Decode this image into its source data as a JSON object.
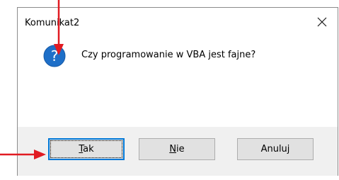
{
  "dialog": {
    "title": "Komunikat2",
    "message": "Czy programowanie w VBA jest fajne?",
    "buttons": [
      {
        "label": "Tak",
        "mnemonic": "T",
        "rest": "ak",
        "default": true
      },
      {
        "label": "Nie",
        "mnemonic": "N",
        "rest": "ie",
        "default": false
      },
      {
        "label": "Anuluj",
        "default": false
      }
    ]
  },
  "icons": {
    "dialog_icon": "question-icon",
    "close": "close-icon"
  },
  "colors": {
    "question_icon": "#1e6fc8",
    "accent_focus": "#0078d7",
    "annotation_arrow": "#e11b22",
    "button_bg": "#e1e1e1",
    "footer_bg": "#f0f0f0"
  }
}
